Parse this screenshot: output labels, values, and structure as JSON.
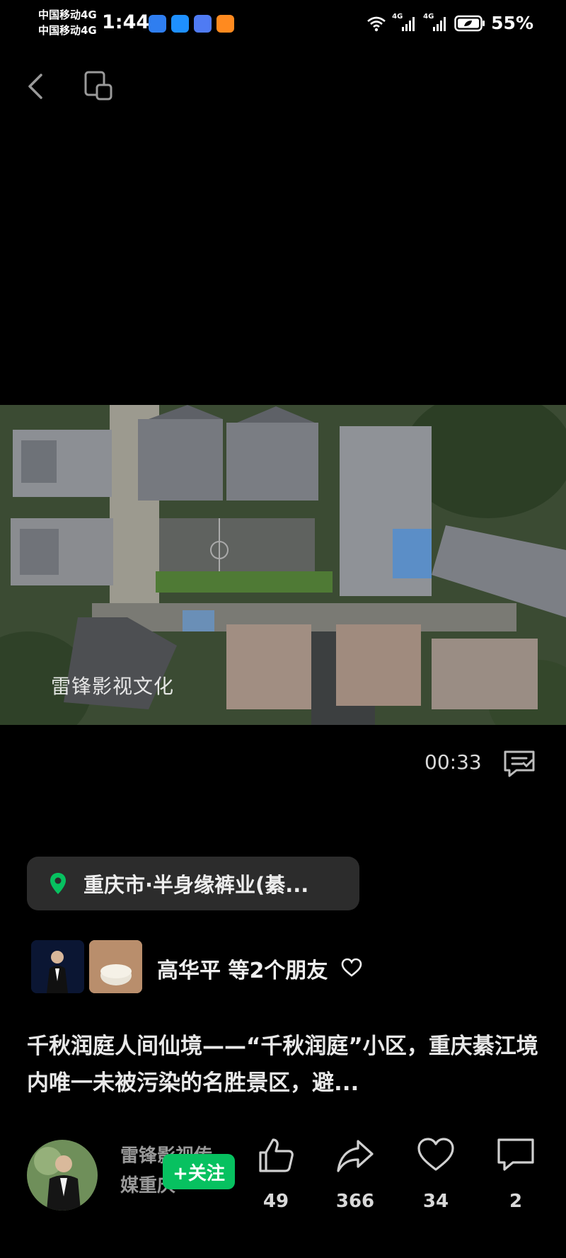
{
  "status_bar": {
    "carrier_1": "中国移动4G",
    "carrier_2": "中国移动4G",
    "time": "1:44",
    "signal_1": "4G",
    "signal_2": "4G",
    "battery": "55%"
  },
  "video": {
    "watermark": "雷锋影视文化",
    "duration": "00:33"
  },
  "location": {
    "label": "重庆市·半身缘裤业(綦..."
  },
  "friends": {
    "text": "高华平 等2个朋友"
  },
  "description": {
    "text": "千秋润庭人间仙境——“千秋润庭”小区，重庆綦江境内唯一未被污染的名胜景区，避..."
  },
  "author": {
    "name": "雷锋影视传媒重庆",
    "follow_label": "+关注"
  },
  "actions": {
    "like_count": "49",
    "share_count": "366",
    "favorite_count": "34",
    "comment_count": "2"
  },
  "colors": {
    "follow_green": "#07c160",
    "pin_green": "#07c160",
    "chip_bg": "#2c2c2c"
  }
}
